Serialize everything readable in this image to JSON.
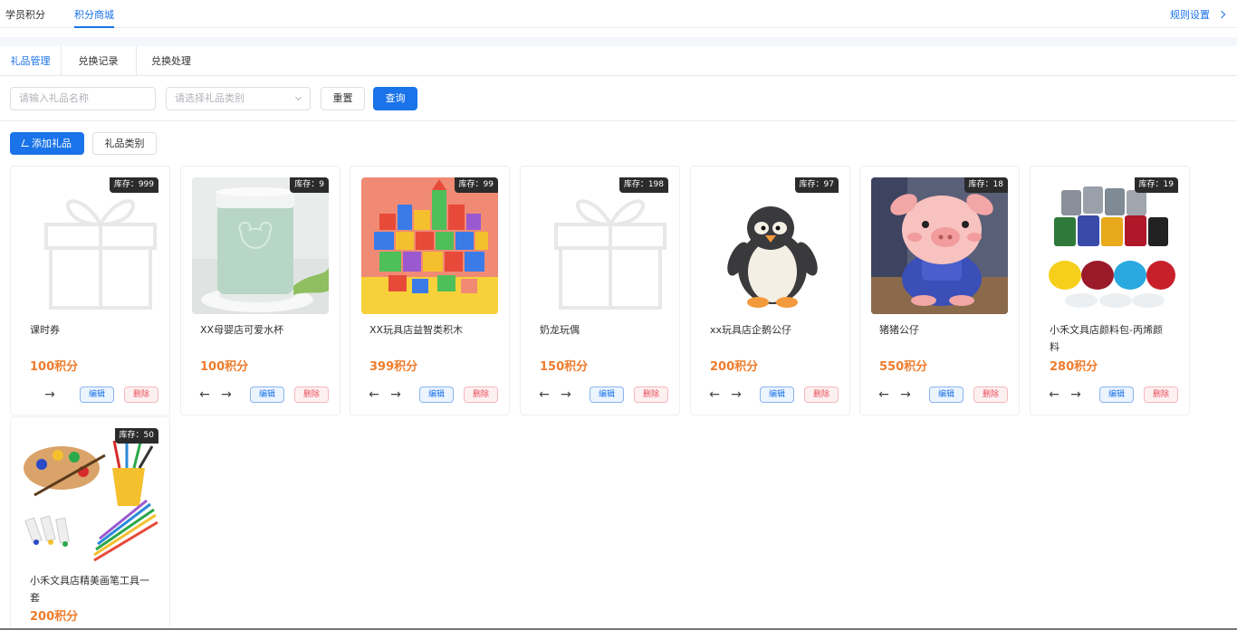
{
  "top_tabs": [
    "学员积分",
    "积分商城"
  ],
  "rules_label": "规则设置",
  "sub_tabs": [
    "礼品管理",
    "兑换记录",
    "兑换处理"
  ],
  "filters": {
    "name_placeholder": "请输入礼品名称",
    "category_placeholder": "请选择礼品类别",
    "reset_label": "重置",
    "query_label": "查询"
  },
  "actions": {
    "add_label": "添加礼品",
    "category_label": "礼品类别"
  },
  "card_labels": {
    "edit": "编辑",
    "delete": "删除",
    "prev": "←",
    "next": "→"
  },
  "products": [
    {
      "stock": "库存：999",
      "name": "课时券",
      "points": "100积分",
      "image": "gift-placeholder"
    },
    {
      "stock": "库存：9",
      "name": "XX母婴店可爱水杯",
      "points": "100积分",
      "image": "cup"
    },
    {
      "stock": "库存：99",
      "name": "XX玩具店益智类积木",
      "points": "399积分",
      "image": "blocks"
    },
    {
      "stock": "库存：198",
      "name": "奶龙玩偶",
      "points": "150积分",
      "image": "gift-placeholder"
    },
    {
      "stock": "库存：97",
      "name": "xx玩具店企鹅公仔",
      "points": "200积分",
      "image": "penguin"
    },
    {
      "stock": "库存：18",
      "name": "猪猪公仔",
      "points": "550积分",
      "image": "pig"
    },
    {
      "stock": "库存：19",
      "name": "小禾文具店颜料包-丙烯颜料",
      "points": "280积分",
      "image": "paints"
    },
    {
      "stock": "库存：50",
      "name": "小禾文具店精美画笔工具一套",
      "points": "200积分",
      "image": "art-tools"
    }
  ]
}
